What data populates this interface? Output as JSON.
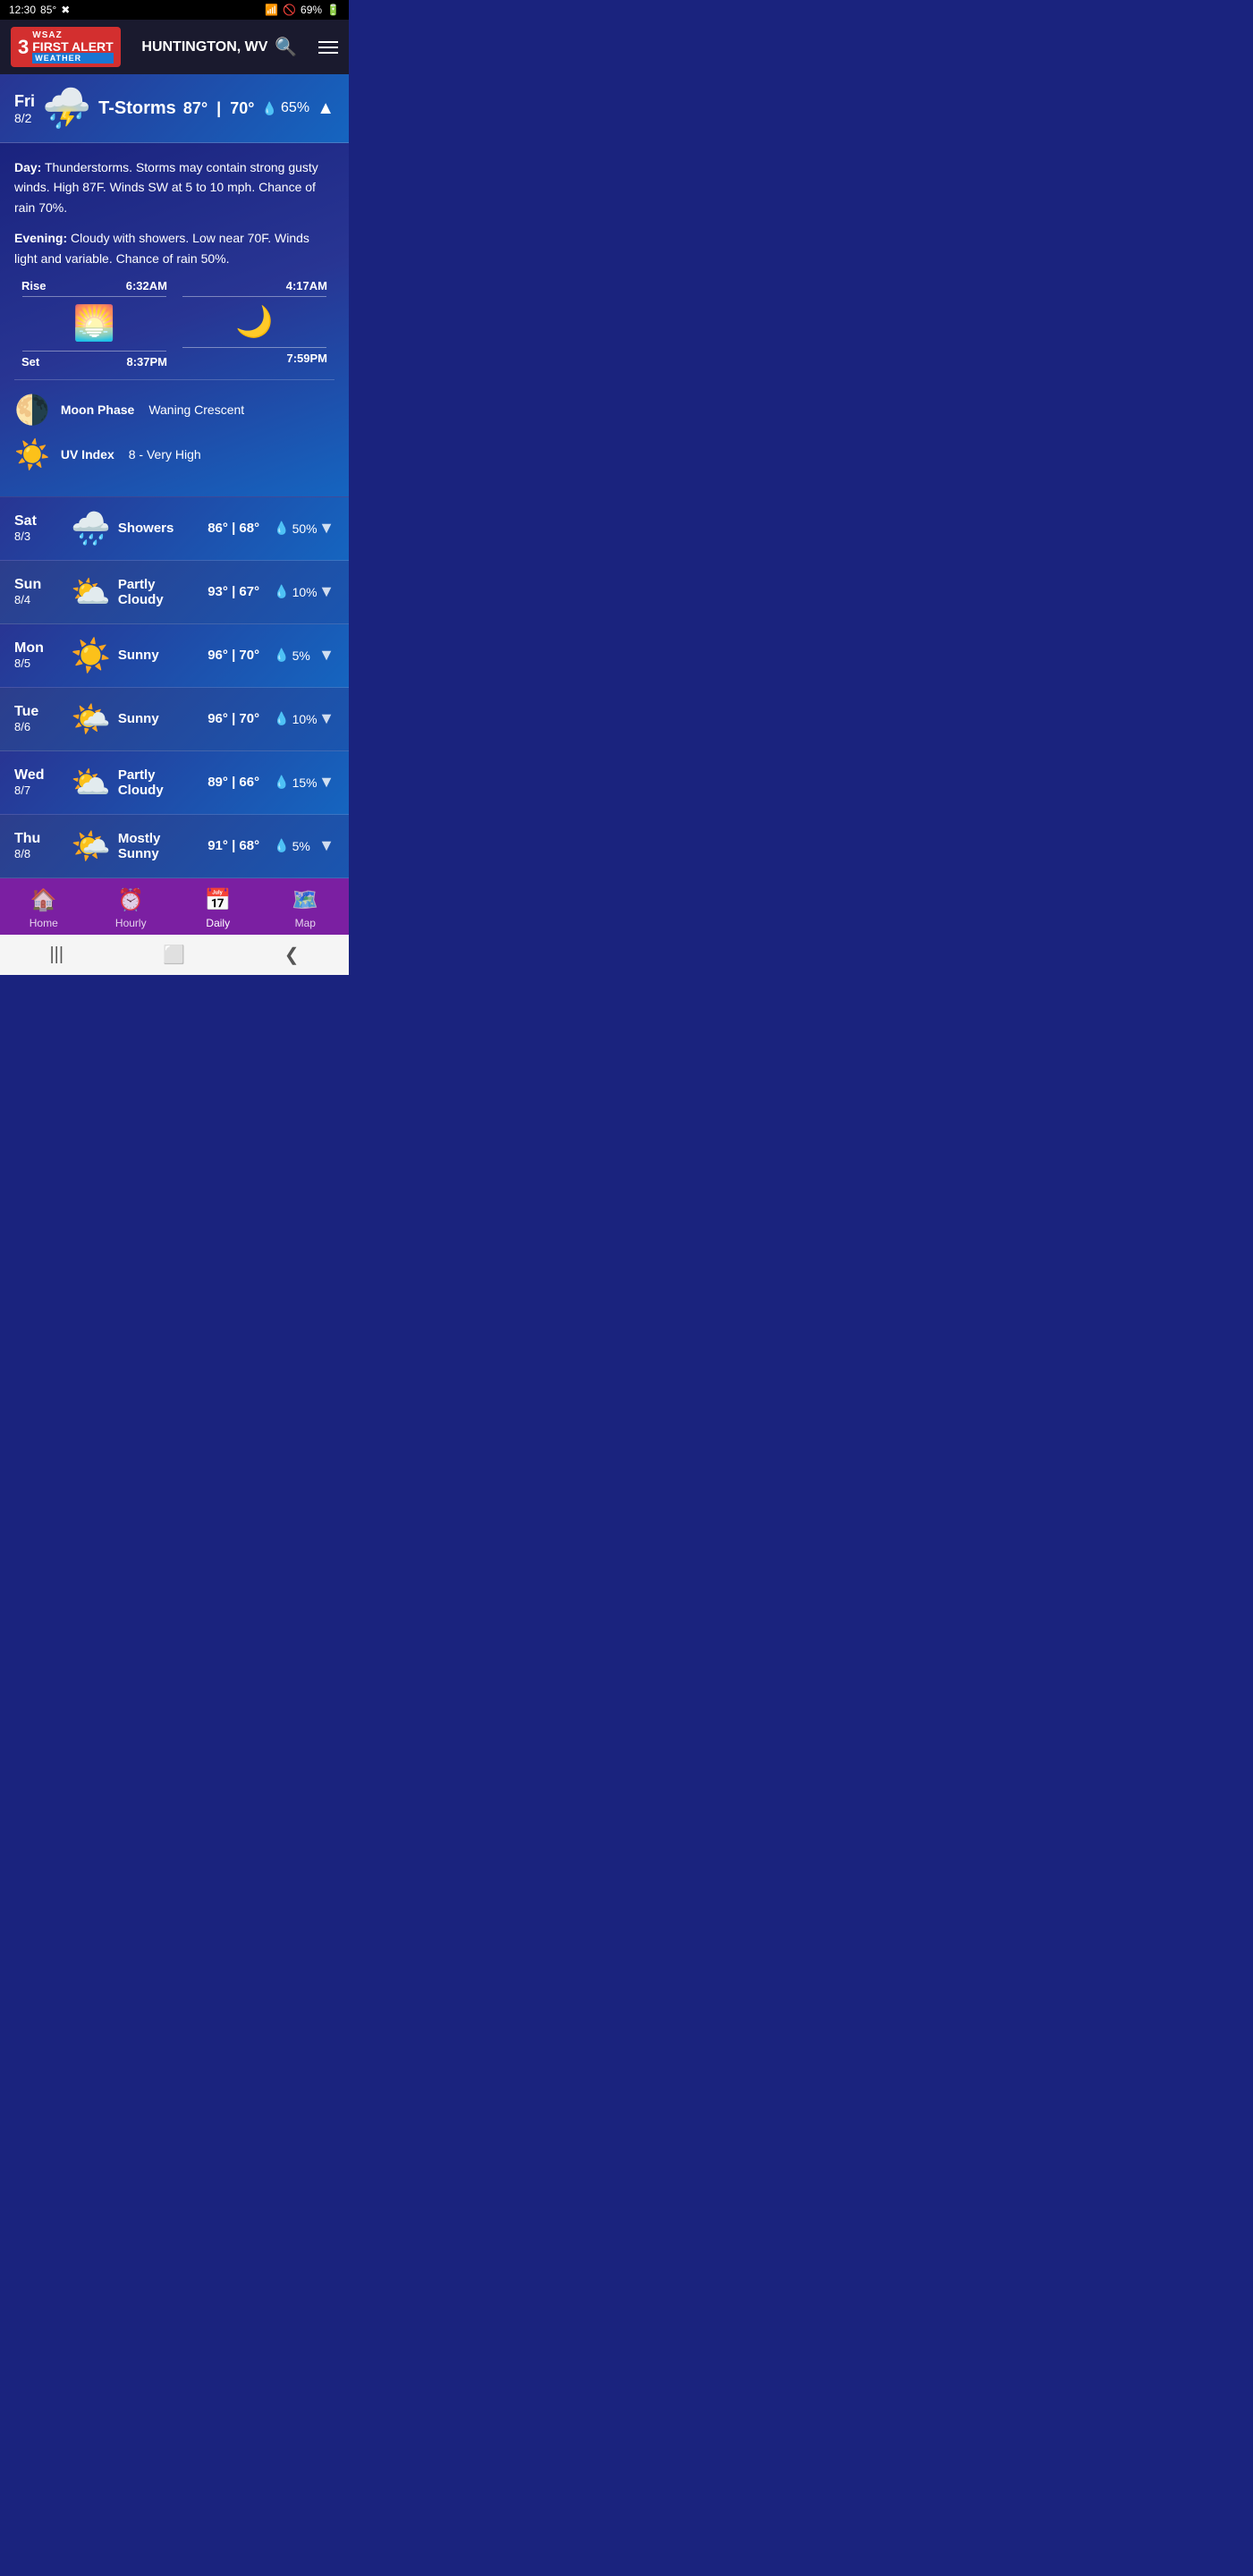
{
  "statusBar": {
    "time": "12:30",
    "temp": "85°",
    "battery": "69%",
    "wifiIcon": "📶",
    "batteryIcon": "🔋"
  },
  "header": {
    "logoNum": "3",
    "logoFirst": "WSAZ",
    "logoAlert": "FIRST ALERT",
    "logoWeather": "WEATHER",
    "location": "HUNTINGTON, WV",
    "menuLabel": "menu"
  },
  "expandedDay": {
    "dayName": "Fri",
    "dayDate": "8/2",
    "condition": "T-Storms",
    "conditionIcon": "⛈️",
    "highTemp": "87°",
    "lowTemp": "70°",
    "precipPct": "65%",
    "detailDay": "Day: Thunderstorms. Storms may contain strong gusty winds. High 87F. Winds SW at 5 to 10 mph. Chance of rain 70%.",
    "detailEvening": "Evening: Cloudy with showers. Low near 70F. Winds light and variable. Chance of rain 50%.",
    "sunriseTime": "6:32AM",
    "sunsetTime": "8:37PM",
    "moonriseTime": "4:17AM",
    "moonsetTime": "7:59PM",
    "moonPhaseLabel": "Moon Phase",
    "moonPhaseValue": "Waning Crescent",
    "uvIndexLabel": "UV Index",
    "uvIndexValue": "8 - Very High",
    "riseLabel": "Rise",
    "setLabel": "Set"
  },
  "forecast": [
    {
      "dayName": "Sat",
      "dayDate": "8/3",
      "condition": "Showers",
      "conditionIcon": "🌧️",
      "highTemp": "86°",
      "lowTemp": "68°",
      "precipPct": "50%"
    },
    {
      "dayName": "Sun",
      "dayDate": "8/4",
      "condition": "Partly Cloudy",
      "conditionIcon": "⛅",
      "highTemp": "93°",
      "lowTemp": "67°",
      "precipPct": "10%"
    },
    {
      "dayName": "Mon",
      "dayDate": "8/5",
      "condition": "Sunny",
      "conditionIcon": "☀️",
      "highTemp": "96°",
      "lowTemp": "70°",
      "precipPct": "5%"
    },
    {
      "dayName": "Tue",
      "dayDate": "8/6",
      "condition": "Sunny",
      "conditionIcon": "🌤️",
      "highTemp": "96°",
      "lowTemp": "70°",
      "precipPct": "10%"
    },
    {
      "dayName": "Wed",
      "dayDate": "8/7",
      "condition": "Partly Cloudy",
      "conditionIcon": "⛅",
      "highTemp": "89°",
      "lowTemp": "66°",
      "precipPct": "15%"
    },
    {
      "dayName": "Thu",
      "dayDate": "8/8",
      "condition": "Mostly Sunny",
      "conditionIcon": "🌤️",
      "highTemp": "91°",
      "lowTemp": "68°",
      "precipPct": "5%"
    }
  ],
  "bottomNav": {
    "items": [
      {
        "label": "Home",
        "icon": "🏠",
        "active": false
      },
      {
        "label": "Hourly",
        "icon": "⏰",
        "active": false
      },
      {
        "label": "Daily",
        "icon": "📅",
        "active": true
      },
      {
        "label": "Map",
        "icon": "🗺️",
        "active": false
      }
    ]
  },
  "sysNav": {
    "backIcon": "❮",
    "homeIcon": "⬜",
    "recentIcon": "|||"
  }
}
